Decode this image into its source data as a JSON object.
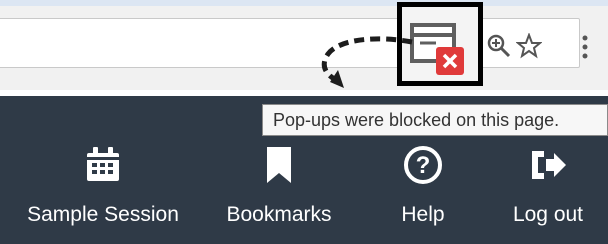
{
  "browser": {
    "tooltip": "Pop-ups were blocked on this page.",
    "icons": [
      "popup-blocked-icon",
      "zoom-icon",
      "bookmark-star-icon",
      "menu-dots-icon"
    ]
  },
  "nav": {
    "items": [
      {
        "label": "Sample Session",
        "icon": "calendar-icon"
      },
      {
        "label": "Bookmarks",
        "icon": "bookmark-icon"
      },
      {
        "label": "Help",
        "icon": "help-icon"
      },
      {
        "label": "Log out",
        "icon": "logout-icon"
      }
    ]
  },
  "colors": {
    "navbar": "#2f3a47",
    "toolbar": "#f1f1f1",
    "blocked_badge": "#e03a3a",
    "highlight_box": "#000000"
  }
}
